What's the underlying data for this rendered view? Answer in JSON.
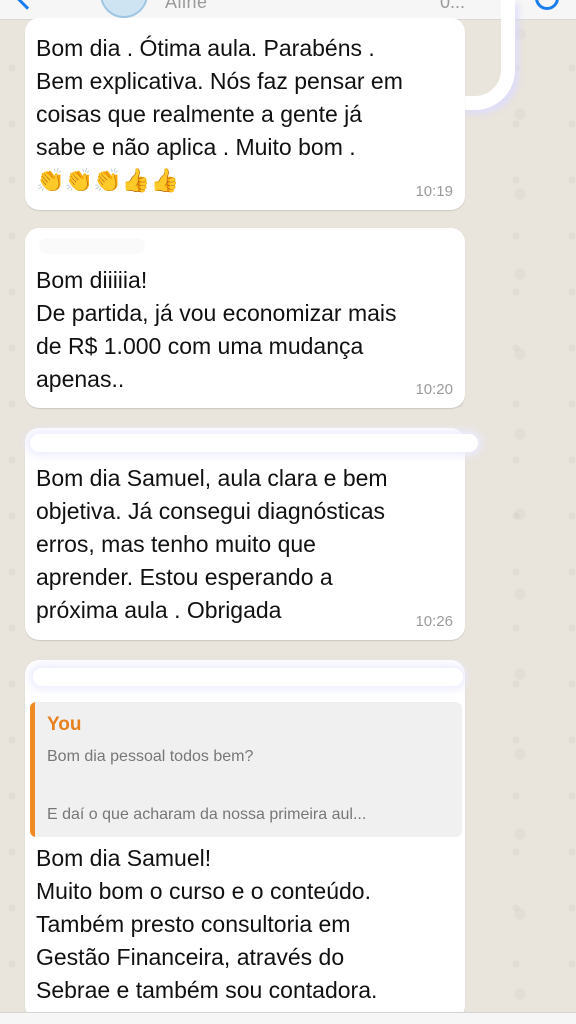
{
  "header": {
    "contact_name": "Aline",
    "status": "0...",
    "back_icon": "back-arrow-icon",
    "call_icon": "call-icon"
  },
  "messages": [
    {
      "text": "Bom dia . Ótima aula. Parabéns .\nBem explicativa. Nós faz pensar em\ncoisas que realmente a gente já\nsabe e não aplica . Muito bom .",
      "emoji": "👏👏👏👍👍",
      "time": "10:19"
    },
    {
      "text": "Bom diiiiia!\nDe partida, já vou economizar mais\nde R$ 1.000 com uma mudança\napenas..",
      "time": "10:20"
    },
    {
      "text": "Bom dia Samuel, aula clara e bem\nobjetiva. Já consegui diagnósticas\nerros, mas tenho muito que\naprender. Estou esperando a\npróxima aula . Obrigada",
      "time": "10:26"
    },
    {
      "quote": {
        "author": "You",
        "line1": "Bom dia pessoal todos bem?",
        "line2": "E daí o que acharam da nossa primeira aul..."
      },
      "text": "Bom dia Samuel!\nMuito bom o curso e o conteúdo.\nTambém presto consultoria em\nGestão Financeira, através do\nSebrae e também sou contadora."
    }
  ]
}
